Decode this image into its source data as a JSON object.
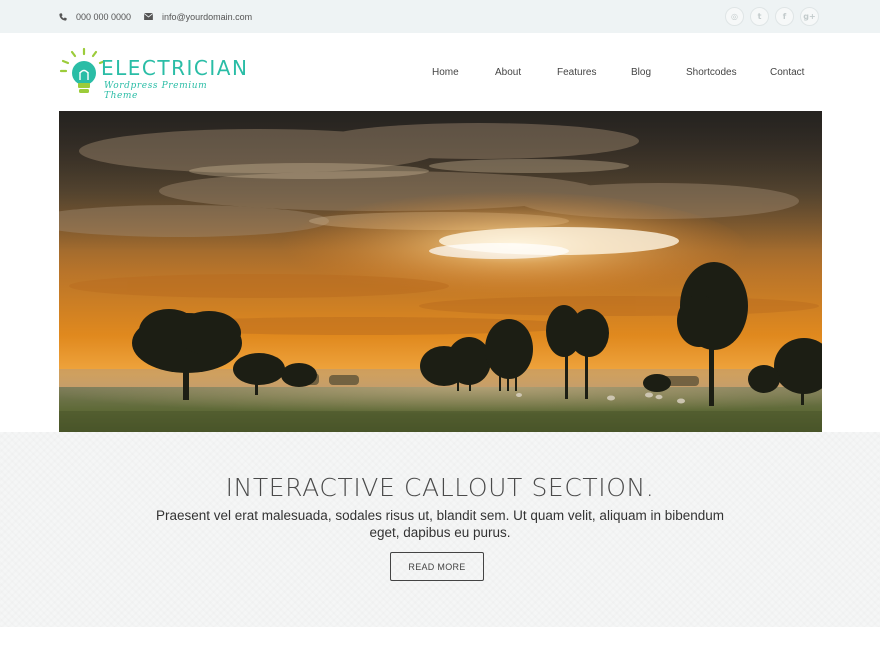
{
  "topbar": {
    "phone": "000 000 0000",
    "email": "info@yourdomain.com",
    "social": [
      {
        "icon": "dribbble-icon",
        "glyph": "◎"
      },
      {
        "icon": "twitter-icon",
        "glyph": "t"
      },
      {
        "icon": "facebook-icon",
        "glyph": "f"
      },
      {
        "icon": "google-plus-icon",
        "glyph": "g+"
      }
    ]
  },
  "header": {
    "logo_title": "ELECTRICIAN",
    "logo_subtitle": "Wordpress Premium Theme",
    "nav": [
      "Home",
      "About",
      "Features",
      "Blog",
      "Shortcodes",
      "Contact"
    ]
  },
  "callout": {
    "title": "INTERACTIVE CALLOUT SECTION.",
    "text": "Praesent vel erat malesuada, sodales risus ut, blandit sem. Ut quam velit, aliquam in bibendum eget, dapibus eu purus.",
    "button": "READ MORE"
  },
  "colors": {
    "brand": "#2abda6",
    "topbar_bg": "#eef3f4",
    "callout_bg": "#f5f6f6"
  }
}
